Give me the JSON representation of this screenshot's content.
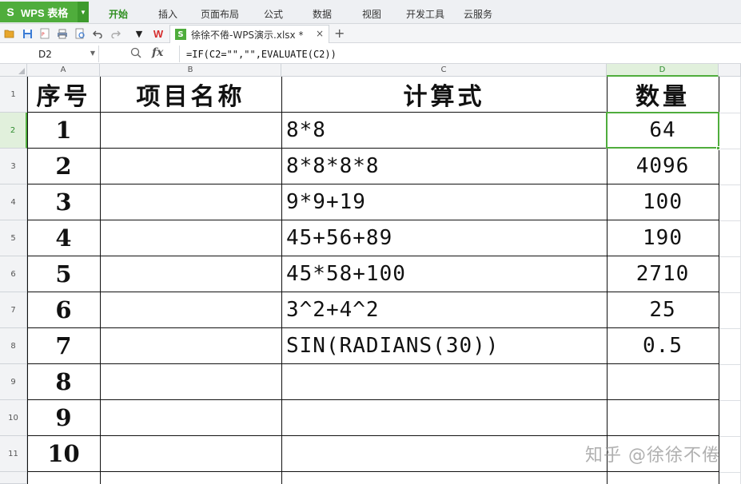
{
  "app": {
    "name": "WPS 表格",
    "brand_color": "#4fad3c"
  },
  "menu": [
    {
      "label": "开始",
      "active": true
    },
    {
      "label": "插入"
    },
    {
      "label": "页面布局"
    },
    {
      "label": "公式"
    },
    {
      "label": "数据"
    },
    {
      "label": "视图"
    },
    {
      "label": "开发工具"
    },
    {
      "label": "云服务"
    }
  ],
  "toolbar": {
    "icons": [
      "open-folder-icon",
      "save-icon",
      "pdf-export-icon",
      "print-icon",
      "print-preview-icon",
      "undo-icon",
      "redo-icon",
      "more-dropdown-icon"
    ],
    "doc_tab": {
      "title": "徐徐不倦-WPS演示.xlsx *",
      "close": "×"
    },
    "new_tab": "+"
  },
  "formula_bar": {
    "cell_ref": "D2",
    "fx": "fx",
    "formula": "=IF(C2=\"\",\"\",EVALUATE(C2))"
  },
  "columns": [
    "A",
    "B",
    "C",
    "D"
  ],
  "rows": [
    "1",
    "2",
    "3",
    "4",
    "5",
    "6",
    "7",
    "8",
    "9",
    "10",
    "11"
  ],
  "table": {
    "headers": [
      "序号",
      "项目名称",
      "计算式",
      "数量"
    ],
    "rows": [
      {
        "no": "1",
        "name": "",
        "expr": "8*8",
        "qty": "64"
      },
      {
        "no": "2",
        "name": "",
        "expr": "8*8*8*8",
        "qty": "4096"
      },
      {
        "no": "3",
        "name": "",
        "expr": "9*9+19",
        "qty": "100"
      },
      {
        "no": "4",
        "name": "",
        "expr": "45+56+89",
        "qty": "190"
      },
      {
        "no": "5",
        "name": "",
        "expr": "45*58+100",
        "qty": "2710"
      },
      {
        "no": "6",
        "name": "",
        "expr": "3^2+4^2",
        "qty": "25"
      },
      {
        "no": "7",
        "name": "",
        "expr": "SIN(RADIANS(30))",
        "qty": "0.5"
      },
      {
        "no": "8",
        "name": "",
        "expr": "",
        "qty": ""
      },
      {
        "no": "9",
        "name": "",
        "expr": "",
        "qty": ""
      },
      {
        "no": "10",
        "name": "",
        "expr": "",
        "qty": ""
      }
    ]
  },
  "selected_cell": "D2",
  "watermark": "知乎 @徐徐不倦"
}
